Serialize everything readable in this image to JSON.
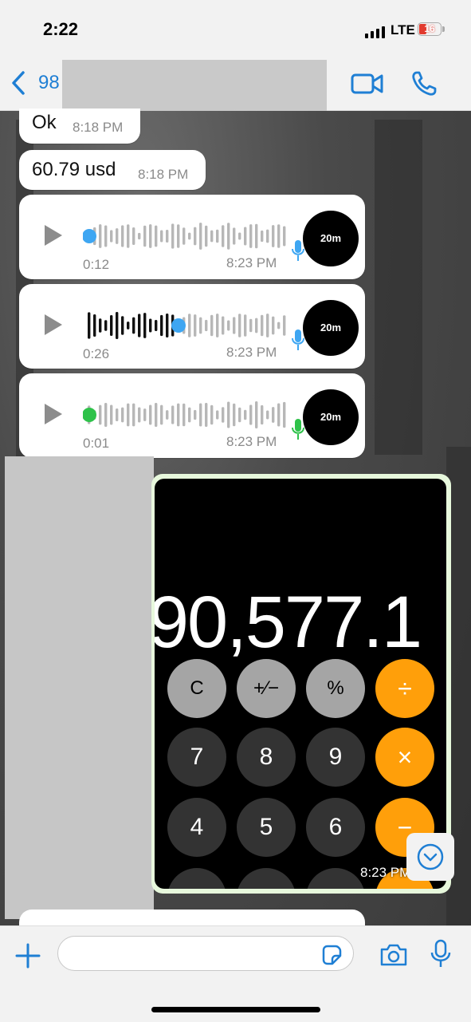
{
  "status": {
    "time": "2:22",
    "network": "LTE",
    "battery": "16"
  },
  "header": {
    "contact": "98",
    "video_icon": "video-camera-icon",
    "call_icon": "phone-icon"
  },
  "messages": [
    {
      "text": "Ok",
      "time": "8:18 PM"
    },
    {
      "text": "60.79 usd",
      "time": "8:18 PM"
    }
  ],
  "voice_notes": [
    {
      "duration": "0:12",
      "time": "8:23 PM",
      "avatar_label": "20m",
      "progress": 0.0,
      "dot_color": "#3ea6f2"
    },
    {
      "duration": "0:26",
      "time": "8:23 PM",
      "avatar_label": "20m",
      "progress": 0.45,
      "dot_color": "#3ea6f2"
    },
    {
      "duration": "0:01",
      "time": "8:23 PM",
      "avatar_label": "20m",
      "progress": 0.0,
      "dot_color": "#2ec24a"
    }
  ],
  "image_message": {
    "display": "90,577.1",
    "time": "8:23 PM",
    "keys": {
      "clear": "C",
      "sign": "+∕−",
      "percent": "%",
      "divide": "÷",
      "seven": "7",
      "eight": "8",
      "nine": "9",
      "multiply": "×",
      "four": "4",
      "five": "5",
      "six": "6",
      "minus": "−"
    }
  },
  "composer": {
    "placeholder": ""
  },
  "colors": {
    "accent": "#1f7fd4",
    "operator": "#ff9f0a",
    "outgoing_bubble": "#e7f8dc"
  }
}
